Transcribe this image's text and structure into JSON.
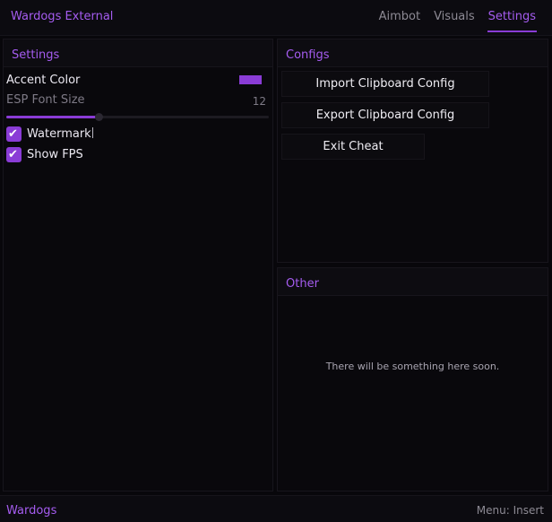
{
  "header": {
    "title": "Wardogs External",
    "tabs": [
      {
        "label": "Aimbot"
      },
      {
        "label": "Visuals"
      },
      {
        "label": "Settings"
      }
    ],
    "active_tab": "Settings"
  },
  "settings": {
    "title": "Settings",
    "accent_color_label": "Accent Color",
    "accent_color": "#8a3cd6",
    "esp_font_size_label": "ESP Font Size",
    "esp_font_size_value": "12",
    "esp_font_size_fraction": 0.35,
    "watermark_label": "Watermark",
    "watermark_checked": true,
    "show_fps_label": "Show FPS",
    "show_fps_checked": true
  },
  "configs": {
    "title": "Configs",
    "import_label": "Import Clipboard Config",
    "export_label": "Export Clipboard Config",
    "exit_label": "Exit Cheat"
  },
  "other": {
    "title": "Other",
    "message": "There will be something here soon."
  },
  "footer": {
    "brand": "Wardogs",
    "menu_hint": "Menu: Insert"
  },
  "colors": {
    "accent": "#a55cf0",
    "accent_dark": "#8a3cd6",
    "background": "#08070b"
  }
}
